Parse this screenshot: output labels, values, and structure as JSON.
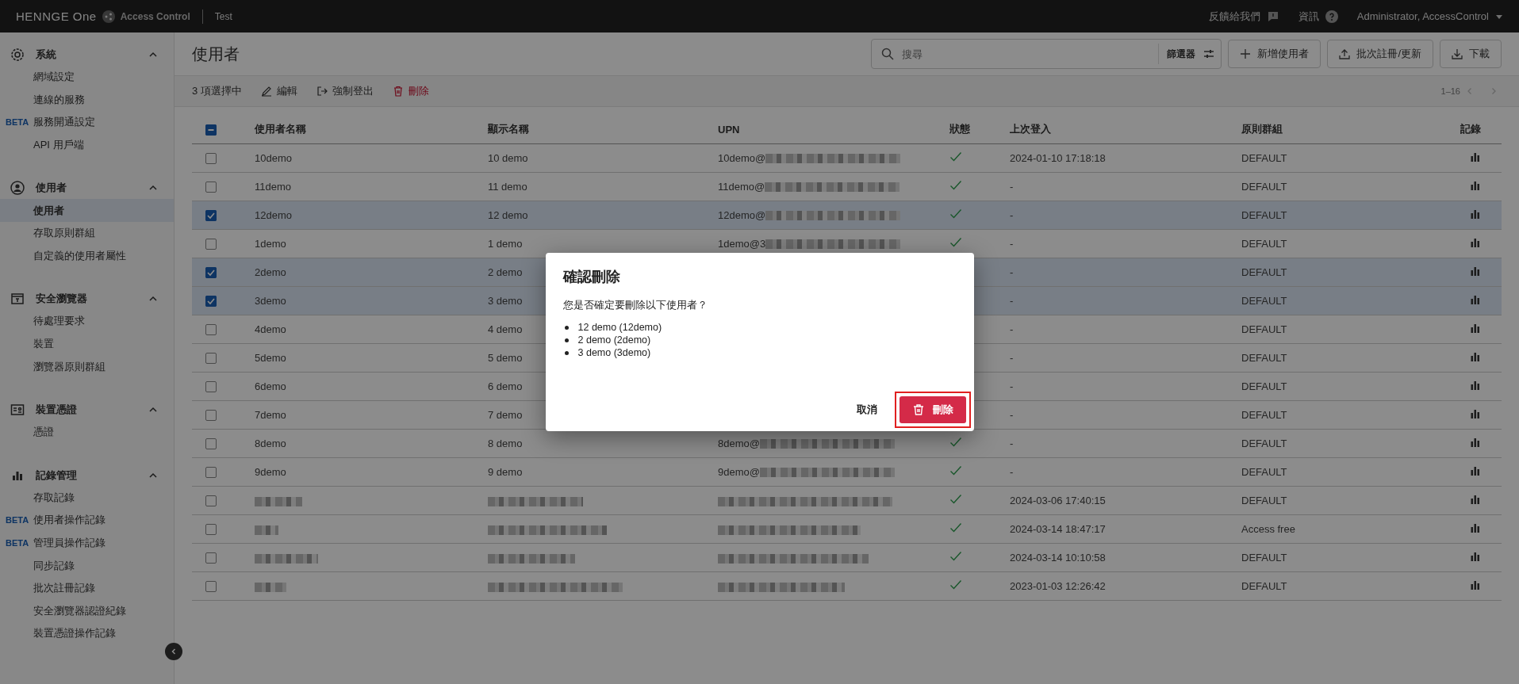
{
  "topbar": {
    "logo": "HENNGE One",
    "product": "Access Control",
    "tenant": "Test",
    "feedback": "反饋給我們",
    "info": "資訊",
    "account": "Administrator, AccessControl"
  },
  "sidebar": {
    "sections": [
      {
        "title": "系統",
        "expanded": true,
        "items": [
          {
            "label": "網域設定",
            "selected": false
          },
          {
            "label": "連線的服務",
            "selected": false
          },
          {
            "label": "服務開通設定",
            "selected": false,
            "badge": "BETA"
          },
          {
            "label": "API 用戶端",
            "selected": false
          }
        ]
      },
      {
        "title": "使用者",
        "expanded": true,
        "items": [
          {
            "label": "使用者",
            "selected": true
          },
          {
            "label": "存取原則群組",
            "selected": false
          },
          {
            "label": "自定義的使用者屬性",
            "selected": false
          }
        ]
      },
      {
        "title": "安全瀏覽器",
        "expanded": true,
        "items": [
          {
            "label": "待處理要求",
            "selected": false
          },
          {
            "label": "裝置",
            "selected": false
          },
          {
            "label": "瀏覽器原則群組",
            "selected": false
          }
        ]
      },
      {
        "title": "裝置憑證",
        "expanded": true,
        "items": [
          {
            "label": "憑證",
            "selected": false
          }
        ]
      },
      {
        "title": "記錄管理",
        "expanded": true,
        "items": [
          {
            "label": "存取記錄",
            "selected": false
          },
          {
            "label": "使用者操作記錄",
            "selected": false,
            "badge": "BETA"
          },
          {
            "label": "管理員操作記錄",
            "selected": false,
            "badge": "BETA"
          },
          {
            "label": "同步記錄",
            "selected": false
          },
          {
            "label": "批次註冊記錄",
            "selected": false
          },
          {
            "label": "安全瀏覽器認證紀錄",
            "selected": false
          },
          {
            "label": "裝置憑證操作記錄",
            "selected": false
          }
        ]
      }
    ]
  },
  "page": {
    "title": "使用者",
    "search": {
      "placeholder": "搜尋"
    },
    "filter": "篩選器",
    "actions": [
      "新增使用者",
      "批次註冊/更新",
      "下載"
    ]
  },
  "selection_bar": {
    "count": "3 項選擇中",
    "actions": [
      "編輯",
      "強制登出",
      "刪除"
    ],
    "pagination": "1–16"
  },
  "table": {
    "select_all_indeterminate": true,
    "columns": [
      "使用者名稱",
      "顯示名稱",
      "UPN",
      "狀態",
      "上次登入",
      "原則群組",
      "記錄"
    ],
    "rows": [
      {
        "kind": "user",
        "selected": false,
        "username": "10demo",
        "display_name": "10 demo",
        "upn": "10demo@",
        "active": true,
        "last_login": "2024-01-10 17:18:18",
        "policy_group": "DEFAULT"
      },
      {
        "kind": "user",
        "selected": false,
        "username": "11demo",
        "display_name": "11 demo",
        "upn": "11demo@",
        "active": true,
        "last_login": "-",
        "policy_group": "DEFAULT"
      },
      {
        "kind": "user",
        "selected": true,
        "username": "12demo",
        "display_name": "12 demo",
        "upn": "12demo@",
        "active": true,
        "last_login": "-",
        "policy_group": "DEFAULT"
      },
      {
        "kind": "user",
        "selected": false,
        "username": "1demo",
        "display_name": "1 demo",
        "upn": "1demo@3",
        "active": true,
        "last_login": "-",
        "policy_group": "DEFAULT"
      },
      {
        "kind": "user",
        "selected": true,
        "username": "2demo",
        "display_name": "2 demo",
        "last_login": "-",
        "policy_group": "DEFAULT"
      },
      {
        "kind": "user",
        "selected": true,
        "username": "3demo",
        "display_name": "3 demo",
        "last_login": "-",
        "policy_group": "DEFAULT"
      },
      {
        "kind": "user",
        "selected": false,
        "username": "4demo",
        "display_name": "4 demo",
        "last_login": "-",
        "policy_group": "DEFAULT"
      },
      {
        "kind": "user",
        "selected": false,
        "username": "5demo",
        "display_name": "5 demo",
        "last_login": "-",
        "policy_group": "DEFAULT"
      },
      {
        "kind": "user",
        "selected": false,
        "username": "6demo",
        "display_name": "6 demo",
        "last_login": "-",
        "policy_group": "DEFAULT"
      },
      {
        "kind": "user",
        "selected": false,
        "username": "7demo",
        "display_name": "7 demo",
        "last_login": "-",
        "policy_group": "DEFAULT"
      },
      {
        "kind": "user",
        "selected": false,
        "username": "8demo",
        "display_name": "8 demo",
        "upn": "8demo@",
        "active": true,
        "last_login": "-",
        "policy_group": "DEFAULT"
      },
      {
        "kind": "user",
        "selected": false,
        "username": "9demo",
        "display_name": "9 demo",
        "upn": "9demo@",
        "active": true,
        "last_login": "-",
        "policy_group": "DEFAULT"
      },
      {
        "kind": "redacted",
        "selected": false,
        "active": true,
        "last_login": "2024-03-06 17:40:15",
        "policy_group": "DEFAULT"
      },
      {
        "kind": "redacted",
        "selected": false,
        "active": true,
        "last_login": "2024-03-14 18:47:17",
        "policy_group": "Access free"
      },
      {
        "kind": "redacted",
        "selected": false,
        "active": true,
        "last_login": "2024-03-14 10:10:58",
        "policy_group": "DEFAULT"
      },
      {
        "kind": "redacted",
        "selected": false,
        "active": true,
        "last_login": "2023-01-03 12:26:42",
        "policy_group": "DEFAULT"
      }
    ]
  },
  "dialog": {
    "title": "確認刪除",
    "message": "您是否確定要刪除以下使用者？",
    "items": [
      "12 demo (12demo)",
      "2 demo (2demo)",
      "3 demo (3demo)"
    ],
    "cancel": "取消",
    "confirm": "刪除"
  }
}
